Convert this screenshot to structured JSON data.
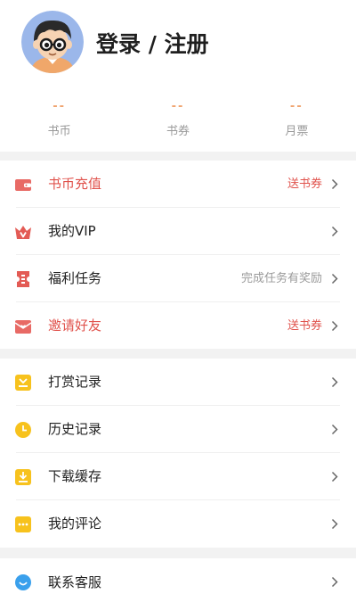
{
  "profile": {
    "login_label": "登录 / 注册"
  },
  "stats": [
    {
      "value": "--",
      "label": "书币"
    },
    {
      "value": "--",
      "label": "书券"
    },
    {
      "value": "--",
      "label": "月票"
    }
  ],
  "menu_group_1": [
    {
      "label": "书币充值",
      "note": "送书券",
      "icon": "wallet-icon"
    },
    {
      "label": "我的VIP",
      "note": "",
      "icon": "vip-crown-icon"
    },
    {
      "label": "福利任务",
      "note": "完成任务有奖励",
      "icon": "ticket-icon"
    },
    {
      "label": "邀请好友",
      "note": "送书券",
      "icon": "invite-envelope-icon"
    }
  ],
  "menu_group_2": [
    {
      "label": "打赏记录",
      "icon": "reward-icon"
    },
    {
      "label": "历史记录",
      "icon": "clock-icon"
    },
    {
      "label": "下载缓存",
      "icon": "download-icon"
    },
    {
      "label": "我的评论",
      "icon": "comment-icon"
    }
  ],
  "menu_group_3": [
    {
      "label": "联系客服",
      "icon": "customer-service-icon"
    }
  ],
  "colors": {
    "accent_red": "#e0524c",
    "accent_orange": "#f0a470",
    "icon_yellow": "#f7c21d"
  }
}
